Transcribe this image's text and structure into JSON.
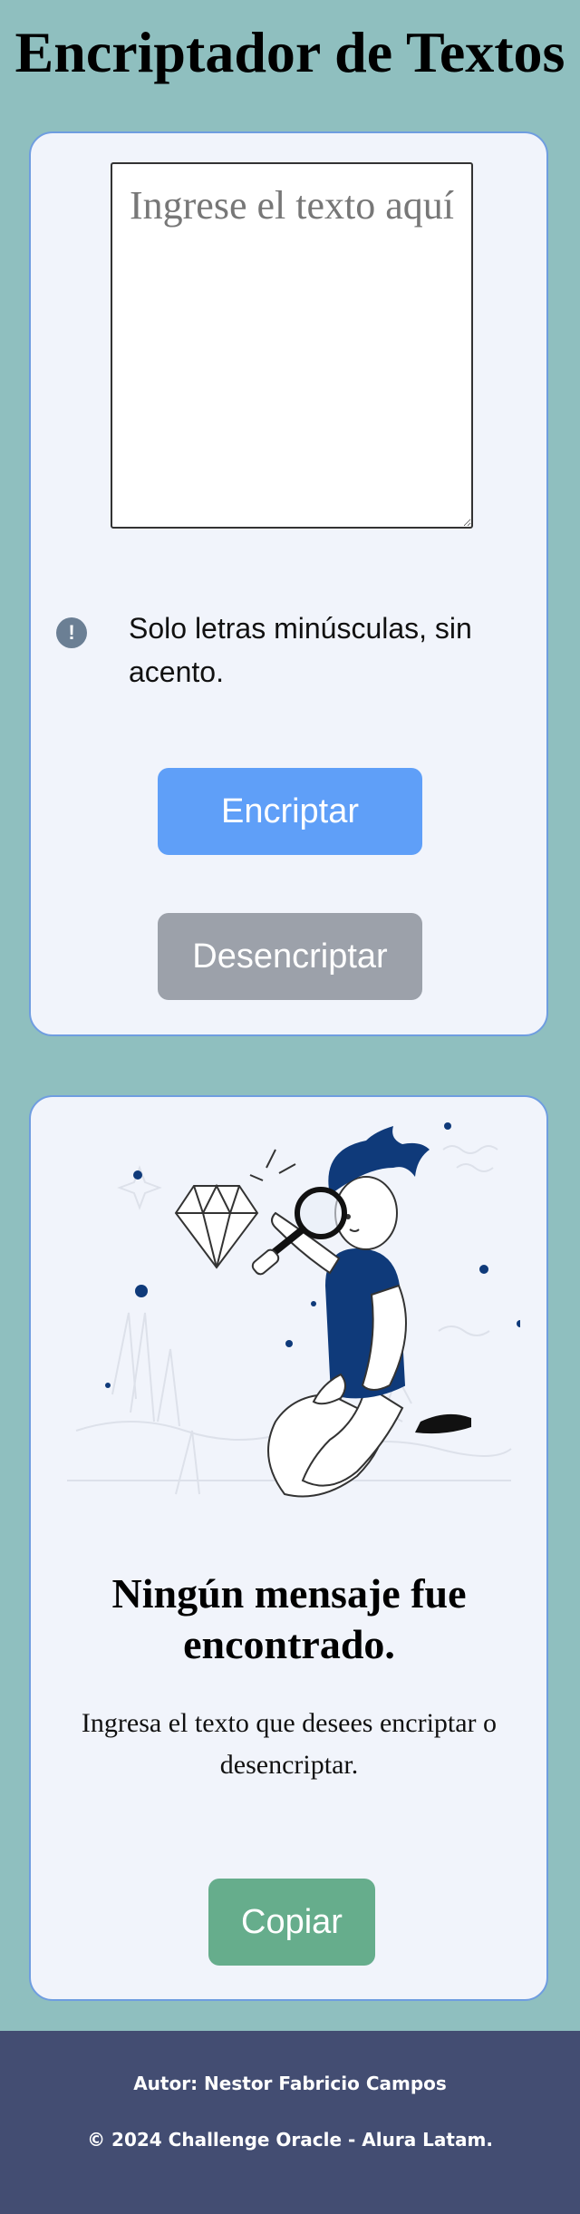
{
  "header": {
    "title": "Encriptador de Textos"
  },
  "input_card": {
    "textarea_placeholder": "Ingrese el texto aquí",
    "textarea_value": "",
    "hint_icon": "exclamation-circle-icon",
    "hint_text": "Solo letras minúsculas, sin acento.",
    "encrypt_label": "Encriptar",
    "decrypt_label": "Desencriptar"
  },
  "output_card": {
    "illustration": "person-with-magnifying-glass-and-diamond",
    "empty_title": "Ningún mensaje fue encontrado.",
    "empty_description": "Ingresa el texto que desees encriptar o desencriptar.",
    "copy_label": "Copiar"
  },
  "footer": {
    "author": "Autor: Nestor Fabricio Campos",
    "copyright": "© 2024 Challenge Oracle - Alura Latam."
  },
  "colors": {
    "page_background": "#8fbfbf",
    "card_background": "#f1f4fb",
    "card_border": "#6f9de0",
    "encrypt_button": "#5f9ff8",
    "decrypt_button": "#9ca1aa",
    "copy_button": "#66ad8c",
    "footer_background": "#434d72",
    "illustration_navy": "#0f3a7a"
  }
}
